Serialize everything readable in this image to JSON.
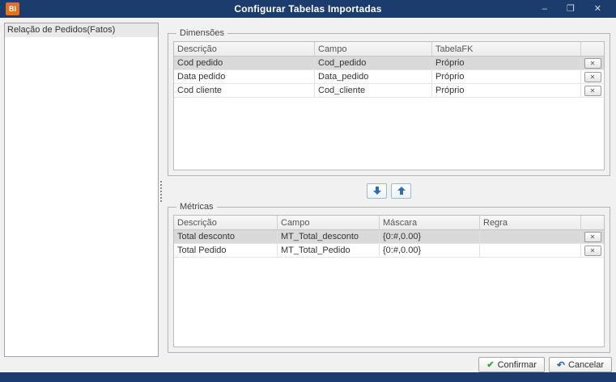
{
  "window": {
    "title": "Configurar Tabelas Importadas",
    "logo_text": "BI",
    "controls": {
      "minimize": "–",
      "maximize": "❐",
      "close": "✕"
    }
  },
  "left_panel": {
    "items": [
      {
        "label": "Relação de Pedidos(Fatos)",
        "selected": true
      }
    ]
  },
  "dimensions_group": {
    "title": "Dimensões",
    "columns": [
      "Descrição",
      "Campo",
      "TabelaFK"
    ],
    "rows": [
      {
        "descricao": "Cod pedido",
        "campo": "Cod_pedido",
        "tabelafk": "Próprio",
        "selected": true
      },
      {
        "descricao": "Data pedido",
        "campo": "Data_pedido",
        "tabelafk": "Próprio",
        "selected": false
      },
      {
        "descricao": "Cod cliente",
        "campo": "Cod_cliente",
        "tabelafk": "Próprio",
        "selected": false
      }
    ]
  },
  "metrics_group": {
    "title": "Métricas",
    "columns": [
      "Descrição",
      "Campo",
      "Máscara",
      "Regra"
    ],
    "rows": [
      {
        "descricao": "Total desconto",
        "campo": "MT_Total_desconto",
        "mascara": "{0:#,0.00}",
        "regra": "",
        "selected": true
      },
      {
        "descricao": "Total Pedido",
        "campo": "MT_Total_Pedido",
        "mascara": "{0:#,0.00}",
        "regra": "",
        "selected": false
      }
    ]
  },
  "icons": {
    "delete": "✕",
    "confirm_check": "✔",
    "cancel_undo": "↶"
  },
  "footer": {
    "confirm_label": "Confirmar",
    "cancel_label": "Cancelar"
  },
  "colors": {
    "titlebar": "#1c3c6e",
    "logo_orange": "#e2711d",
    "arrow_blue": "#2e6db6",
    "selected_row": "#d9d9d9"
  }
}
